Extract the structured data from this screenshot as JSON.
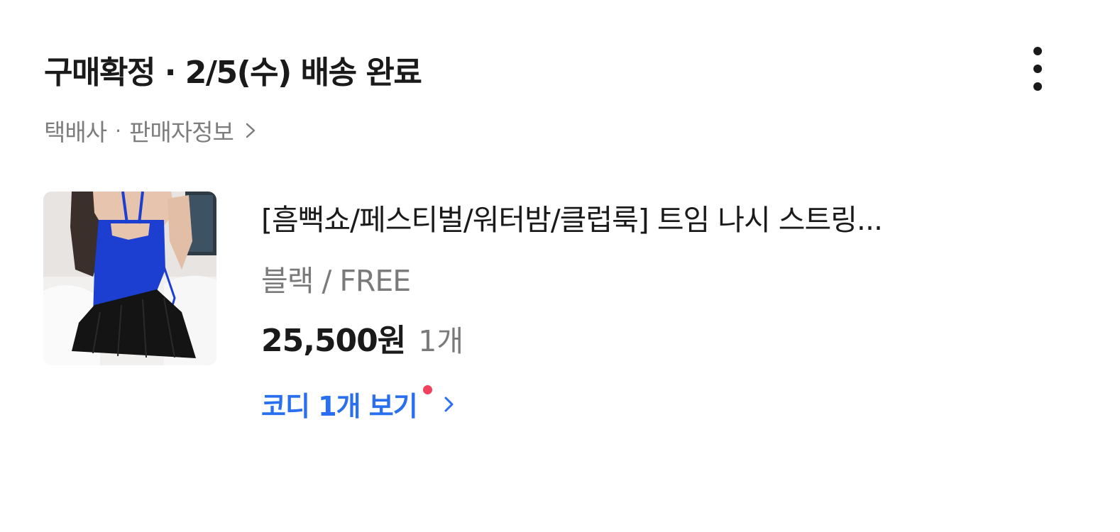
{
  "order": {
    "status_text": "구매확정 · 2/5(수) 배송 완료",
    "more_menu_icon": "more-vertical-icon"
  },
  "links": {
    "carrier_label": "택배사",
    "separator": "·",
    "seller_info_label": "판매자정보",
    "chevron_icon": "chevron-right-icon"
  },
  "product": {
    "thumbnail_icon": "product-photo",
    "name": "[흠뻑쇼/페스티벌/워터밤/클럽룩] 트임 나시 스트링...",
    "option": "블랙 / FREE",
    "price": "25,500원",
    "quantity": "1개"
  },
  "coordi": {
    "label": "코디 1개 보기",
    "has_new": true,
    "accent_color": "#2a6ff0",
    "new_dot_color": "#f0425c"
  }
}
